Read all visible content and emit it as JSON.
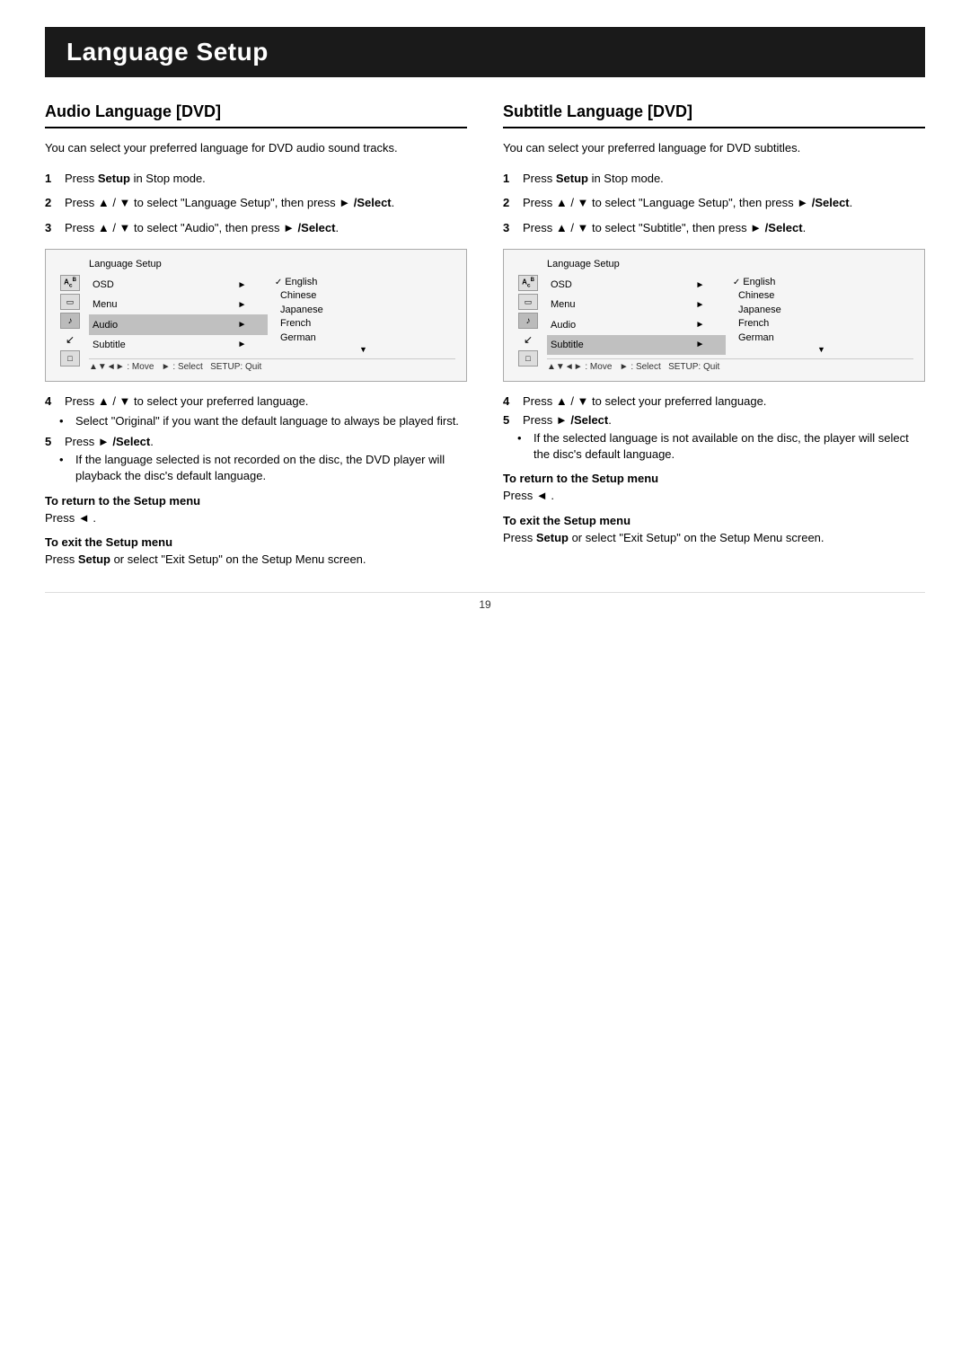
{
  "page": {
    "title": "Language Setup",
    "page_number": "19"
  },
  "audio_section": {
    "heading": "Audio Language [DVD]",
    "intro": "You can select your preferred language for DVD audio sound tracks.",
    "steps": [
      {
        "num": "1",
        "text_plain": "Press ",
        "text_bold": "Setup",
        "text_after": " in Stop mode."
      },
      {
        "num": "2",
        "text_plain": "Press ▲ / ▼ to select \"Language Setup\", then press ► ",
        "text_bold": "/Select",
        "text_after": "."
      },
      {
        "num": "3",
        "text_plain": "Press ▲ / ▼ to select \"Audio\", then press ► ",
        "text_bold": "/Select",
        "text_after": "."
      }
    ],
    "screenshot": {
      "title": "Language Setup",
      "menu_items": [
        "OSD",
        "Menu",
        "Audio",
        "Subtitle"
      ],
      "highlighted": "Audio",
      "languages": [
        "English",
        "Chinese",
        "Japanese",
        "French",
        "German"
      ],
      "checked_lang": "English",
      "footer": "▲▼◄► : Move   ► : Select   SETUP: Quit"
    },
    "step4": "Press ▲ / ▼ to select your preferred language.",
    "step4_bullets": [
      "Select \"Original\" if you want the default language to always be played first."
    ],
    "step5_num": "5",
    "step5_text_plain": "Press ► ",
    "step5_text_bold": "/Select",
    "step5_after": ".",
    "step5_bullets": [
      "If the language selected is not recorded on the disc, the DVD player will playback the disc's default language."
    ],
    "return_heading": "To return to the Setup menu",
    "return_text": "Press ◄ .",
    "exit_heading": "To exit the Setup menu",
    "exit_text_plain": "Press ",
    "exit_text_bold": "Setup",
    "exit_text_after": " or select \"Exit Setup\" on the Setup Menu screen."
  },
  "subtitle_section": {
    "heading": "Subtitle Language [DVD]",
    "intro": "You can select your preferred language for DVD subtitles.",
    "steps": [
      {
        "num": "1",
        "text_plain": "Press ",
        "text_bold": "Setup",
        "text_after": " in Stop mode."
      },
      {
        "num": "2",
        "text_plain": "Press ▲ / ▼ to select \"Language Setup\", then press ► ",
        "text_bold": "/Select",
        "text_after": "."
      },
      {
        "num": "3",
        "text_plain": "Press ▲ / ▼ to select \"Subtitle\", then press ► ",
        "text_bold": "/Select",
        "text_after": "."
      }
    ],
    "screenshot": {
      "title": "Language Setup",
      "menu_items": [
        "OSD",
        "Menu",
        "Audio",
        "Subtitle"
      ],
      "highlighted": "Subtitle",
      "languages": [
        "English",
        "Chinese",
        "Japanese",
        "French",
        "German"
      ],
      "checked_lang": "English",
      "footer": "▲▼◄► : Move   ► : Select   SETUP: Quit"
    },
    "step4": "Press ▲ / ▼ to select your preferred language.",
    "step5_num": "5",
    "step5_text_plain": "Press ► ",
    "step5_text_bold": "/Select",
    "step5_after": ".",
    "step5_bullets": [
      "If the selected language is not available on the disc, the player will select the disc's default language."
    ],
    "return_heading": "To return to the Setup menu",
    "return_text": "Press ◄ .",
    "exit_heading": "To exit the Setup menu",
    "exit_text_plain": "Press ",
    "exit_text_bold": "Setup",
    "exit_text_after": " or select \"Exit Setup\" on the Setup Menu screen."
  }
}
